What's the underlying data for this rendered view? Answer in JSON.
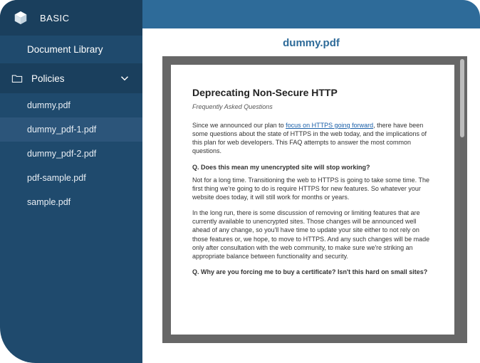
{
  "brand": {
    "title": "BASIC"
  },
  "sidebar": {
    "library_label": "Document Library",
    "folder_label": "Policies",
    "files": [
      {
        "name": "dummy.pdf"
      },
      {
        "name": "dummy_pdf-1.pdf"
      },
      {
        "name": "dummy_pdf-2.pdf"
      },
      {
        "name": "pdf-sample.pdf"
      },
      {
        "name": "sample.pdf"
      }
    ],
    "selected_index": 1
  },
  "document": {
    "title": "dummy.pdf",
    "heading": "Deprecating Non-Secure HTTP",
    "subheading": "Frequently Asked Questions",
    "intro_before": "Since we announced our plan to ",
    "intro_link": "focus on HTTPS going forward",
    "intro_after": ", there have been some questions about the state of HTTPS in the web today, and the implications of this plan for web developers.  This FAQ attempts to answer the most common questions.",
    "q1": "Q. Does this mean my unencrypted site will stop working?",
    "a1a": "Not for a long time.  Transitioning the web to HTTPS is going to take some time.  The first thing we're going to do is require HTTPS for new features.  So whatever your website does today, it will still work for months or years.",
    "a1b": "In the long run, there is some discussion of removing or limiting features that are currently available to unencrypted sites.  Those changes will be announced well ahead of any change, so you'll have time to update your site either to not rely on those features or, we hope, to move to HTTPS.  And any such changes will be made only after consultation with the web community, to make sure we're striking an appropriate balance between functionality and security.",
    "q2": "Q. Why are you forcing me to buy a certificate?  Isn't this hard on small sites?"
  }
}
